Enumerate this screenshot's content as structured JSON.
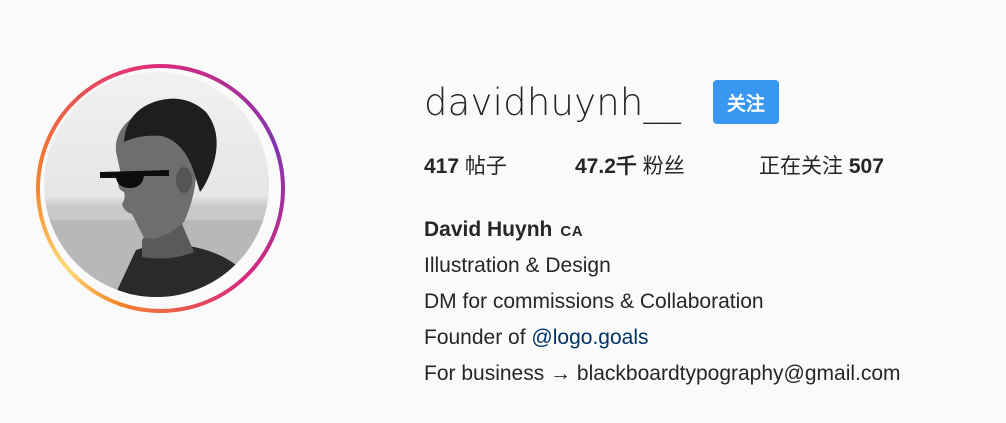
{
  "profile": {
    "username": "davidhuynh__",
    "follow_label": "关注",
    "stats": {
      "posts_count": "417",
      "posts_label": "帖子",
      "followers_count": "47.2千",
      "followers_label": "粉丝",
      "following_label": "正在关注",
      "following_count": "507"
    },
    "bio": {
      "full_name": "David Huynh",
      "full_name_suffix": "CA",
      "line1": "Illustration & Design",
      "line2": "DM for commissions & Collaboration",
      "line3_prefix": "Founder of",
      "line3_mention": "@logo.goals",
      "line4": "For business → blackboardtypography@gmail.com"
    }
  },
  "colors": {
    "follow_button": "#3897f0",
    "mention_link": "#003569",
    "background": "#fafafa"
  }
}
